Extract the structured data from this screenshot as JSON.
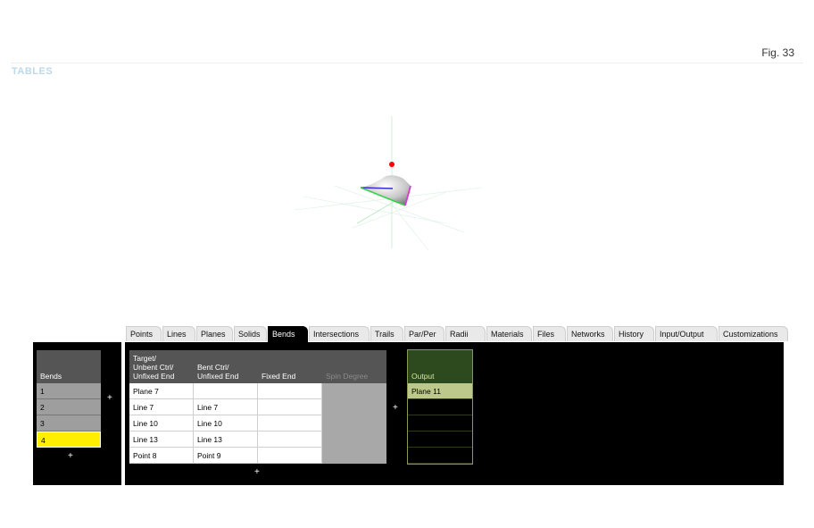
{
  "figure_label": "Fig. 33",
  "section_title": "TABLES",
  "tabs": [
    {
      "label": "Points",
      "w": 40
    },
    {
      "label": "Lines",
      "w": 37
    },
    {
      "label": "Planes",
      "w": 41
    },
    {
      "label": "Solids",
      "w": 37
    },
    {
      "label": "Bends",
      "w": 45,
      "active": true
    },
    {
      "label": "Intersections",
      "w": 68
    },
    {
      "label": "Trails",
      "w": 37
    },
    {
      "label": "Par/Per",
      "w": 45
    },
    {
      "label": "Radii",
      "w": 45
    },
    {
      "label": "Materials",
      "w": 51
    },
    {
      "label": "Files",
      "w": 37
    },
    {
      "label": "Networks",
      "w": 52
    },
    {
      "label": "History",
      "w": 45
    },
    {
      "label": "Input/Output",
      "w": 70
    },
    {
      "label": "Customizations",
      "w": 78
    }
  ],
  "bends_table": {
    "header": "Bends",
    "rows": [
      "1",
      "2",
      "3",
      "4"
    ],
    "selected_row": "4",
    "add_label": "+"
  },
  "main_table": {
    "headers": {
      "target": "Target/\nUnbent Ctrl/\nUnfixed End",
      "bent": "Bent Ctrl/\nUnfixed End",
      "fixed": "Fixed End",
      "spin": "Spin Degree"
    },
    "rows": [
      {
        "target": "Plane 7",
        "bent": "",
        "fixed": ""
      },
      {
        "target": "Line 7",
        "bent": "Line 7",
        "fixed": ""
      },
      {
        "target": "Line 10",
        "bent": "Line 10",
        "fixed": ""
      },
      {
        "target": "Line 13",
        "bent": "Line 13",
        "fixed": ""
      },
      {
        "target": "Point 8",
        "bent": "Point 9",
        "fixed": ""
      }
    ],
    "add_row_label": "+",
    "add_column_label": "+",
    "left_add_label": "+"
  },
  "output_table": {
    "header": "Output",
    "rows": [
      "Plane 11",
      "",
      "",
      "",
      ""
    ]
  },
  "colors": {
    "selected_row": "#ffee00",
    "output_selected": "#bcc98a",
    "output_header": "#2d4a1e",
    "red_point": "#ff0000"
  }
}
